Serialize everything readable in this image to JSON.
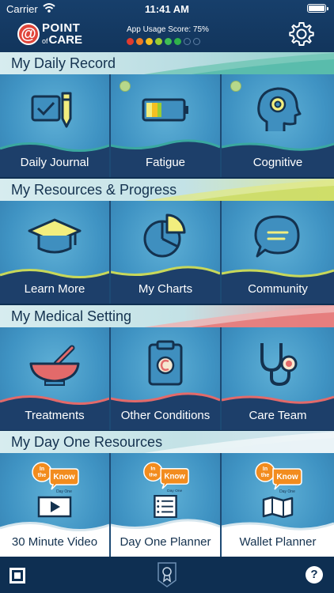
{
  "status": {
    "carrier": "Carrier",
    "time": "11:41 AM"
  },
  "header": {
    "logo_top": "POINT",
    "logo_of": "of",
    "logo_bottom": "CARE",
    "usage_label": "App Usage Score: 75%",
    "usage_score": 0.75,
    "dots": [
      "#e23b2e",
      "#f07b22",
      "#f4c021",
      "#9acd32",
      "#3fbf54",
      "#2fb34a",
      "empty",
      "empty"
    ]
  },
  "sections": [
    {
      "title": "My Daily Record",
      "tiles": [
        {
          "label": "Daily Journal",
          "icon": "journal-checkbox-icon",
          "dot": false
        },
        {
          "label": "Fatigue",
          "icon": "battery-icon",
          "dot": true
        },
        {
          "label": "Cognitive",
          "icon": "head-gear-icon",
          "dot": true
        }
      ]
    },
    {
      "title": "My Resources & Progress",
      "tiles": [
        {
          "label": "Learn More",
          "icon": "graduation-cap-icon"
        },
        {
          "label": "My Charts",
          "icon": "pie-chart-icon"
        },
        {
          "label": "Community",
          "icon": "chat-bubble-icon"
        }
      ]
    },
    {
      "title": "My Medical Setting",
      "tiles": [
        {
          "label": "Treatments",
          "icon": "mortar-pestle-icon"
        },
        {
          "label": "Other Conditions",
          "icon": "clipboard-icon"
        },
        {
          "label": "Care Team",
          "icon": "stethoscope-icon"
        }
      ]
    },
    {
      "title": "My Day One Resources",
      "tiles": [
        {
          "label": "30 Minute Video",
          "icon": "video-play-icon"
        },
        {
          "label": "Day One Planner",
          "icon": "checklist-icon"
        },
        {
          "label": "Wallet Planner",
          "icon": "folded-map-icon"
        }
      ]
    }
  ],
  "in_the_know": {
    "line1": "In",
    "line2": "the",
    "line3": "Know",
    "line4": "Day One"
  },
  "footer": {
    "help": "?"
  },
  "colors": {
    "navy": "#0e2f52",
    "tile_blue": "#3f93c3",
    "icon_yellow": "#f2ee7e",
    "wave_teal": "#3aa8a0",
    "wave_yellow": "#c8d85a",
    "wave_red": "#e36a6a",
    "wave_white": "#d6e6ee"
  }
}
